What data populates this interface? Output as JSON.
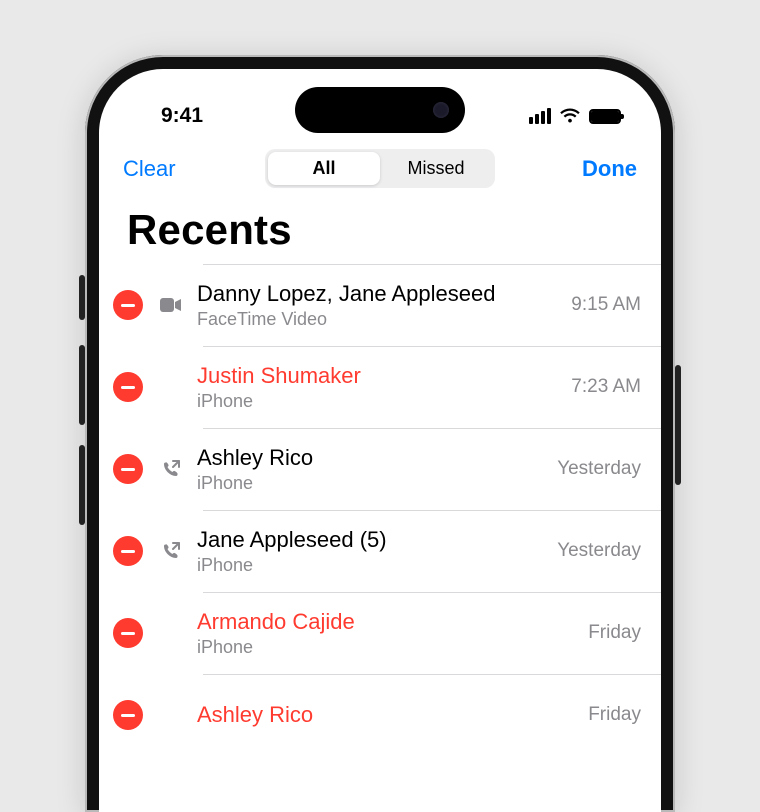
{
  "status": {
    "time": "9:41"
  },
  "nav": {
    "clear_label": "Clear",
    "done_label": "Done",
    "segments": {
      "all": "All",
      "missed": "Missed"
    },
    "selected_segment": "all"
  },
  "header": {
    "title": "Recents"
  },
  "calls": [
    {
      "name": "Danny Lopez, Jane Appleseed",
      "sub": "FaceTime Video",
      "time": "9:15 AM",
      "missed": false,
      "icon": "facetime"
    },
    {
      "name": "Justin Shumaker",
      "sub": "iPhone",
      "time": "7:23 AM",
      "missed": true,
      "icon": "none"
    },
    {
      "name": "Ashley Rico",
      "sub": "iPhone",
      "time": "Yesterday",
      "missed": false,
      "icon": "outgoing"
    },
    {
      "name": "Jane Appleseed (5)",
      "sub": "iPhone",
      "time": "Yesterday",
      "missed": false,
      "icon": "outgoing"
    },
    {
      "name": "Armando Cajide",
      "sub": "iPhone",
      "time": "Friday",
      "missed": true,
      "icon": "none"
    },
    {
      "name": "Ashley Rico",
      "sub": "",
      "time": "Friday",
      "missed": true,
      "icon": "none"
    }
  ]
}
